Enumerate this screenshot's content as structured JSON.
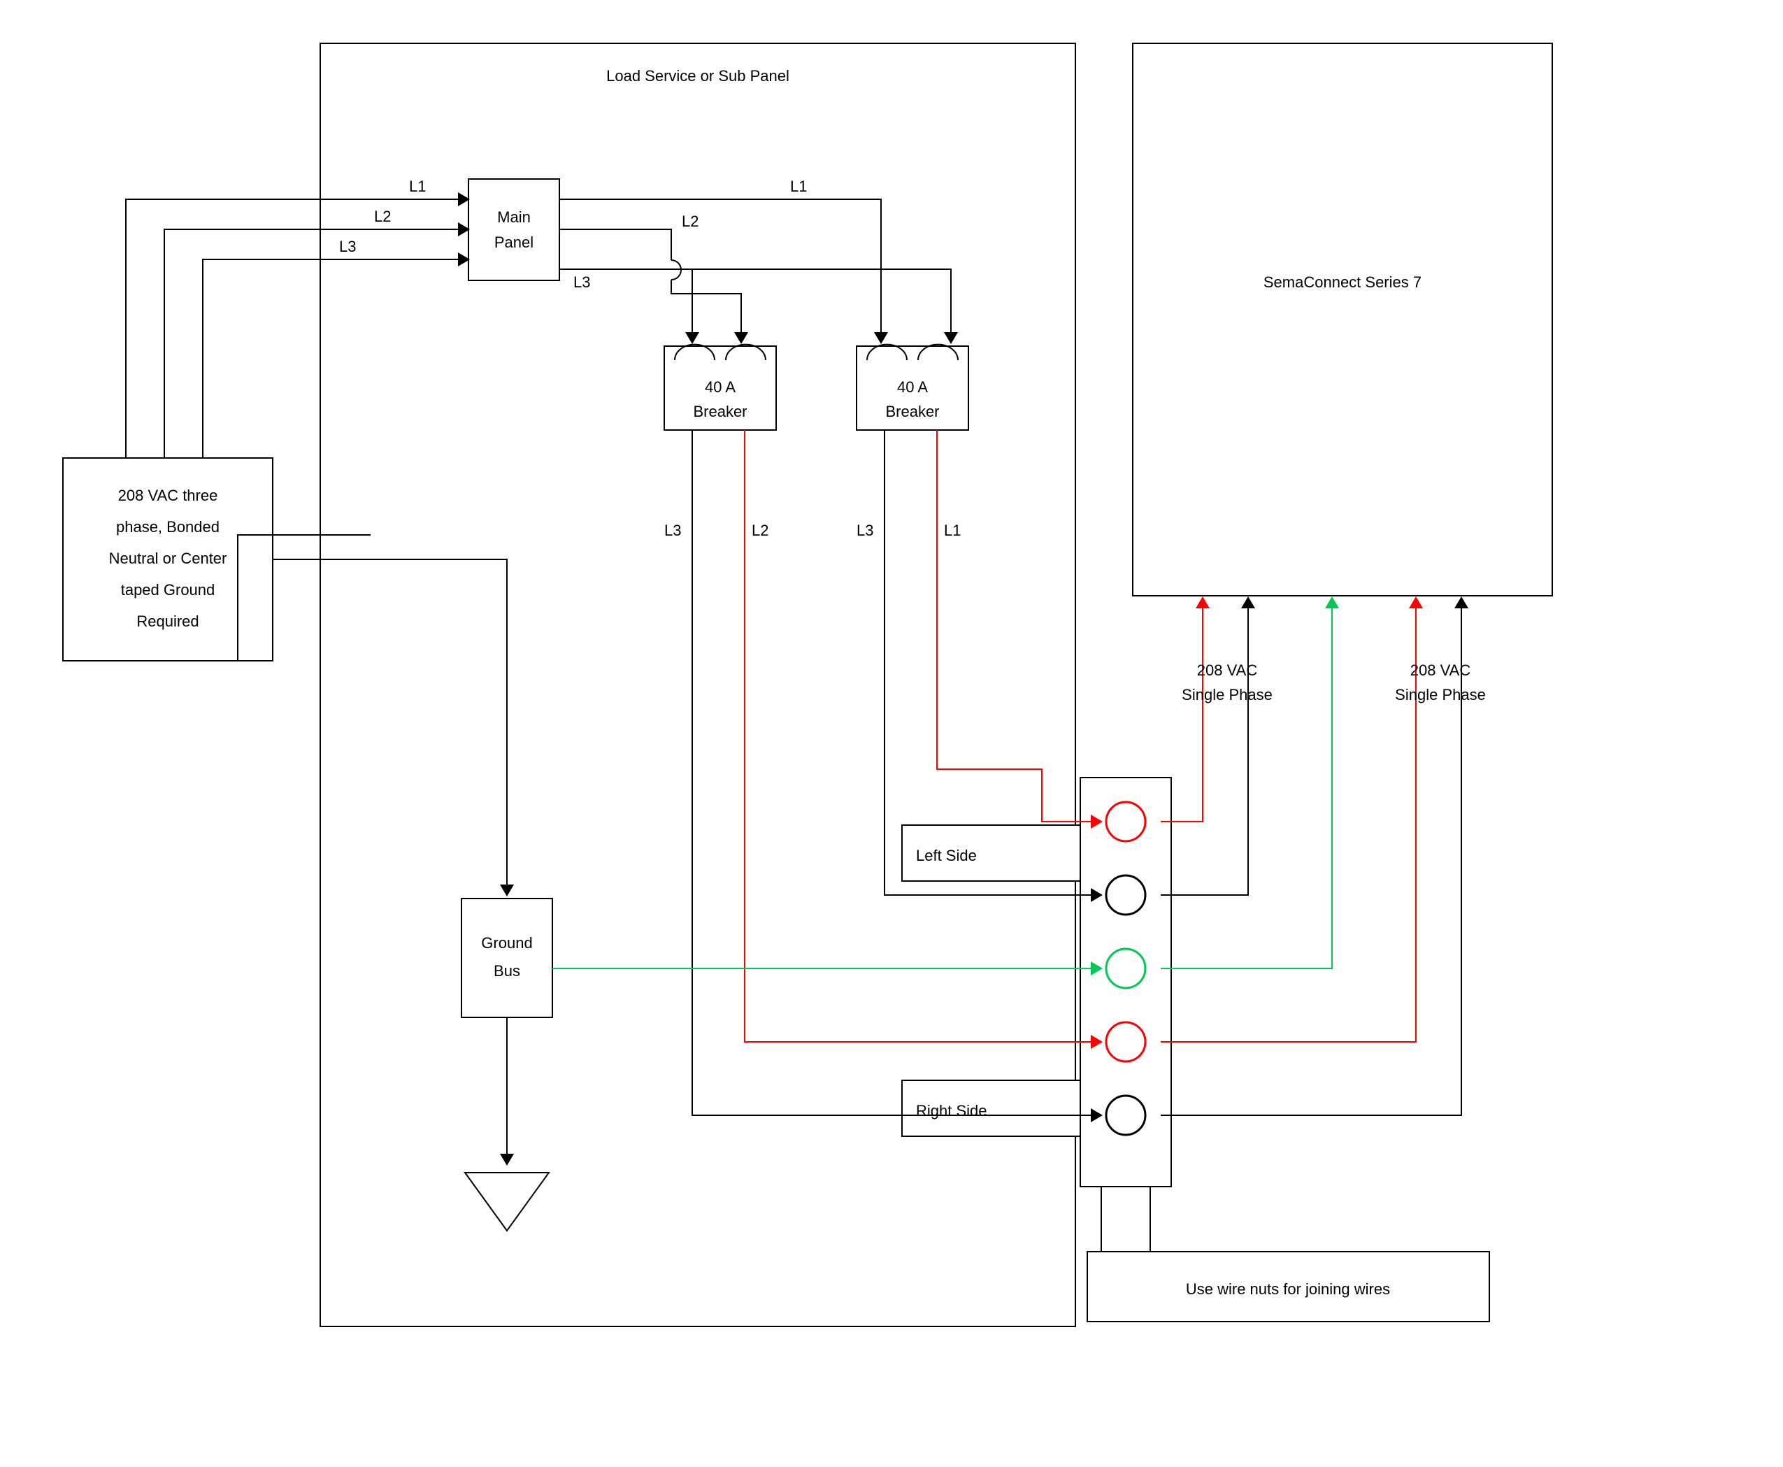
{
  "diagram": {
    "source_box": {
      "line1": "208 VAC three",
      "line2": "phase, Bonded",
      "line3": "Neutral or Center",
      "line4": "taped Ground",
      "line5": "Required"
    },
    "panel_title": "Load Service or Sub Panel",
    "main_panel": {
      "line1": "Main",
      "line2": "Panel"
    },
    "breaker_a": {
      "line1": "40 A",
      "line2": "Breaker"
    },
    "breaker_b": {
      "line1": "40 A",
      "line2": "Breaker"
    },
    "ground_bus": {
      "line1": "Ground",
      "line2": "Bus"
    },
    "labels": {
      "L1_a": "L1",
      "L2_a": "L2",
      "L3_a": "L3",
      "L1_b": "L1",
      "L2_b": "L2",
      "L3_b": "L3",
      "brk_a_L3": "L3",
      "brk_a_L2": "L2",
      "brk_b_L3": "L3",
      "brk_b_L1": "L1",
      "left_side": "Left Side",
      "right_side": "Right Side",
      "vac_left": {
        "line1": "208 VAC",
        "line2": "Single Phase"
      },
      "vac_right": {
        "line1": "208 VAC",
        "line2": "Single Phase"
      }
    },
    "device": "SemaConnect Series 7",
    "wire_note": "Use wire nuts for joining wires"
  }
}
